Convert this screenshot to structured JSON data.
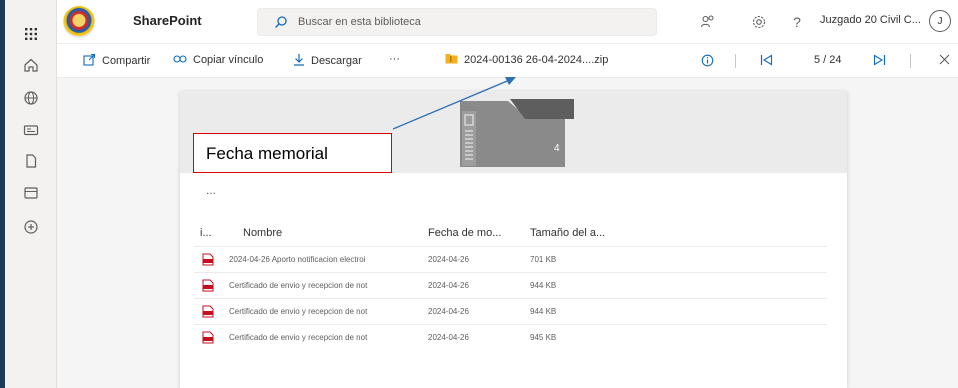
{
  "app": {
    "site_title": "SharePoint",
    "search_placeholder": "Buscar en esta biblioteca",
    "account_name": "Juzgado 20 Civil C...",
    "avatar_initial": "J"
  },
  "rail": {
    "icons": [
      "home-icon",
      "globe-icon",
      "news-icon",
      "document-icon",
      "list-icon",
      "add-icon"
    ]
  },
  "header_icons": [
    "share-people-icon",
    "settings-icon",
    "help-icon"
  ],
  "commands": {
    "share_label": "Compartir",
    "copy_link_label": "Copiar vínculo",
    "download_label": "Descargar",
    "more_label": "···",
    "file_name": "2024-00136 26-04-2024....zip",
    "pager": "5 / 24"
  },
  "preview": {
    "folder_count": "4",
    "more_dots": "...",
    "columns": {
      "type": "i...",
      "name": "Nombre",
      "date": "Fecha de mo...",
      "size": "Tamaño del a..."
    },
    "rows": [
      {
        "name": "2024-04-26 Aporto notificacion electroi",
        "date": "2024-04-26",
        "size": "701 KB"
      },
      {
        "name": "Certificado de envio y recepcion de not",
        "date": "2024-04-26",
        "size": "944 KB"
      },
      {
        "name": "Certificado de envio y recepcion de not",
        "date": "2024-04-26",
        "size": "944 KB"
      },
      {
        "name": "Certificado de envio y recepcion de not",
        "date": "2024-04-26",
        "size": "945 KB"
      }
    ]
  },
  "annotation": {
    "label": "Fecha memorial"
  },
  "colors": {
    "accent": "#0f6cbd",
    "annotation_border": "#e00000",
    "arrow": "#2f6fb5",
    "pdf_icon": "#c50f1f"
  }
}
